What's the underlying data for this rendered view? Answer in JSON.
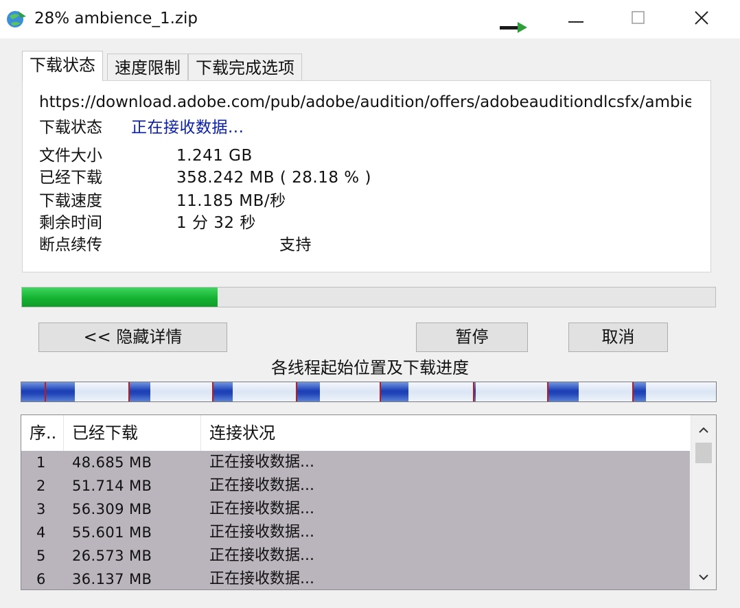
{
  "window": {
    "title": "28% ambience_1.zip",
    "controls": [
      "minimize-icon",
      "maximize-icon",
      "close-icon"
    ]
  },
  "tabs": [
    {
      "label": "下载状态",
      "active": true
    },
    {
      "label": "速度限制",
      "active": false
    },
    {
      "label": "下载完成选项",
      "active": false
    }
  ],
  "details": {
    "url": "https://download.adobe.com/pub/adobe/audition/offers/adobeauditiondlcsfx/ambience",
    "status_label": "下载状态",
    "status_value": "正在接收数据...",
    "file_size_label": "文件大小",
    "file_size_value": "1.241  GB",
    "downloaded_label": "已经下载",
    "downloaded_value": "358.242  MB ( 28.18 % )",
    "speed_label": "下载速度",
    "speed_value": "11.185  MB/秒",
    "remaining_label": "剩余时间",
    "remaining_value": "1 分 32 秒",
    "resume_label": "断点续传",
    "resume_value": "支持"
  },
  "progress": {
    "percent": 28.18,
    "color": "#14b232"
  },
  "buttons": {
    "hide_details": "<< 隐藏详情",
    "pause": "暂停",
    "cancel": "取消"
  },
  "threads": {
    "label": "各线程起始位置及下载进度",
    "color": "#1c3fb6"
  },
  "connections": {
    "columns": [
      "序..",
      "已经下载",
      "连接状况"
    ],
    "rows": [
      {
        "idx": "1",
        "downloaded": "48.685 MB",
        "status": "正在接收数据..."
      },
      {
        "idx": "2",
        "downloaded": "51.714 MB",
        "status": "正在接收数据..."
      },
      {
        "idx": "3",
        "downloaded": "56.309 MB",
        "status": "正在接收数据..."
      },
      {
        "idx": "4",
        "downloaded": "55.601 MB",
        "status": "正在接收数据..."
      },
      {
        "idx": "5",
        "downloaded": "26.573 MB",
        "status": "正在接收数据..."
      },
      {
        "idx": "6",
        "downloaded": "36.137 MB",
        "status": "正在接收数据..."
      }
    ]
  }
}
